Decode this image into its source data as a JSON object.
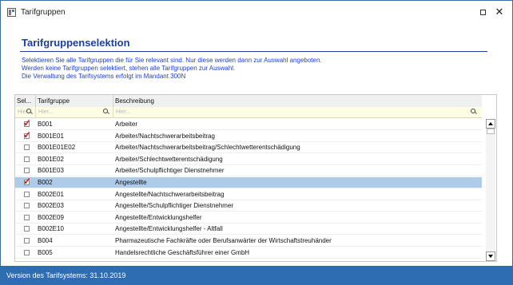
{
  "window": {
    "title": "Tarifgruppen"
  },
  "content": {
    "heading": "Tarifgruppenselektion",
    "description": [
      "Selektieren Sie alle Tarifgruppen die für Sie relevant sind. Nur diese werden dann zur Auswahl angeboten.",
      "Werden keine Tarifgruppen selektiert, stehen alle Tarifgruppen zur Auswahl.",
      "Die Verwaltung des Tarifsystems erfolgt im Mandant 300N"
    ]
  },
  "grid": {
    "columns": [
      "Sel...",
      "Tarifgruppe",
      "Beschreibung"
    ],
    "filter_placeholders": [
      "Hier...",
      "Hier...",
      "Hier..."
    ],
    "rows": [
      {
        "checked": true,
        "code": "B001",
        "description": "Arbeiter"
      },
      {
        "checked": true,
        "code": "B001E01",
        "description": "Arbeiter/Nachtschwerarbeitsbeitrag"
      },
      {
        "checked": false,
        "code": "B001E01E02",
        "description": "Arbeiter/Nachtschwerarbeitsbeitrag/Schlechtwetterentschädigung"
      },
      {
        "checked": false,
        "code": "B001E02",
        "description": "Arbeiter/Schlechtwetterentschädigung"
      },
      {
        "checked": false,
        "code": "B001E03",
        "description": "Arbeiter/Schulpflichtiger Dienstnehmer"
      },
      {
        "checked": true,
        "code": "B002",
        "description": "Angestellte",
        "selected": true
      },
      {
        "checked": false,
        "code": "B002E01",
        "description": "Angestellte/Nachtschwerarbeitsbeitrag"
      },
      {
        "checked": false,
        "code": "B002E03",
        "description": "Angestellte/Schulpflichtiger Dienstnehmer"
      },
      {
        "checked": false,
        "code": "B002E09",
        "description": "Angestellte/Entwicklungshelfer"
      },
      {
        "checked": false,
        "code": "B002E10",
        "description": "Angestellte/Entwicklungshelfer - Altfall"
      },
      {
        "checked": false,
        "code": "B004",
        "description": "Pharmazeutische Fachkräfte oder Berufsanwärter der Wirtschaftstreuhänder"
      },
      {
        "checked": false,
        "code": "B005",
        "description": "Handelsrechtliche Geschäftsführer einer GmbH"
      }
    ]
  },
  "status": {
    "text": "Version des Tarifsystems: 31.10.2019"
  },
  "colors": {
    "accent": "#1f3f9e",
    "description": "#1f3fd6",
    "status_bg": "#2f6db2",
    "selected_row": "#aecbea",
    "filter_bg": "#fdfde4",
    "check": "#d11a1a"
  }
}
